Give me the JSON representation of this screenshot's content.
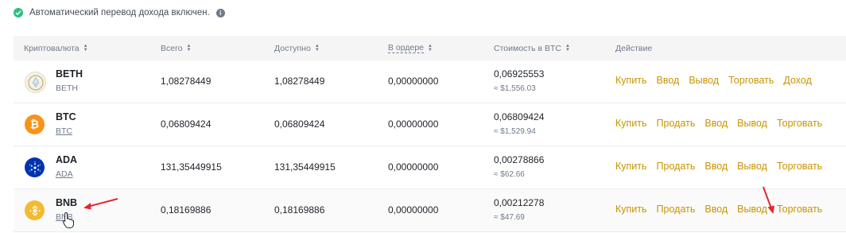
{
  "notice": {
    "text": "Автоматический перевод дохода включен."
  },
  "header": {
    "coin": "Криптовалюта",
    "total": "Всего",
    "available": "Доступно",
    "in_order": "В ордере",
    "btc_value": "Стоимость в BTC",
    "action": "Действие"
  },
  "rows": [
    {
      "symbol": "BETH",
      "name": "BETH",
      "total": "1,08278449",
      "available": "1,08278449",
      "in_order": "0,00000000",
      "btc": "0,06925553",
      "usd": "≈ $1,556.03",
      "actions": [
        "Купить",
        "Ввод",
        "Вывод",
        "Торговать",
        "Доход"
      ]
    },
    {
      "symbol": "BTC",
      "name": "BTC",
      "total": "0,06809424",
      "available": "0,06809424",
      "in_order": "0,00000000",
      "btc": "0,06809424",
      "usd": "≈ $1,529.94",
      "actions": [
        "Купить",
        "Продать",
        "Ввод",
        "Вывод",
        "Торговать"
      ]
    },
    {
      "symbol": "ADA",
      "name": "ADA",
      "total": "131,35449915",
      "available": "131,35449915",
      "in_order": "0,00000000",
      "btc": "0,00278866",
      "usd": "≈ $62.66",
      "actions": [
        "Купить",
        "Продать",
        "Ввод",
        "Вывод",
        "Торговать"
      ]
    },
    {
      "symbol": "BNB",
      "name": "BNB",
      "total": "0,18169886",
      "available": "0,18169886",
      "in_order": "0,00000000",
      "btc": "0,00212278",
      "usd": "≈ $47.69",
      "actions": [
        "Купить",
        "Продать",
        "Ввод",
        "Вывод",
        "Торговать"
      ]
    }
  ],
  "colors": {
    "accent": "#c99400",
    "annotation": "#e5252a",
    "success": "#2ebd85"
  }
}
